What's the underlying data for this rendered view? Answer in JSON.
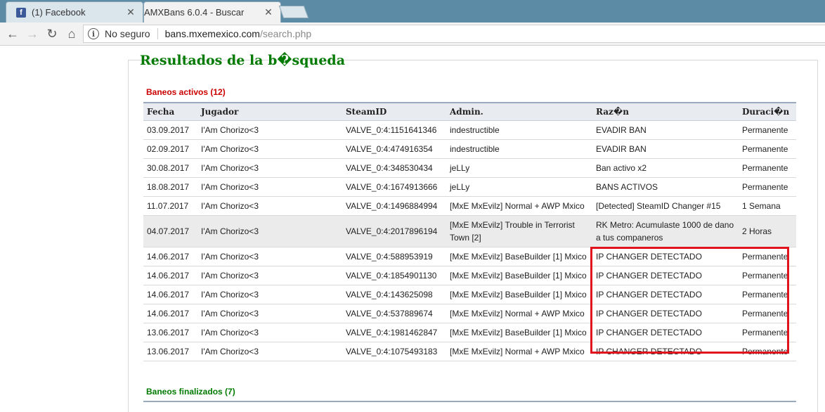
{
  "browser": {
    "tabs": [
      {
        "title": "(1) Facebook",
        "favicon": "facebook-icon",
        "active": false
      },
      {
        "title": "AMXBans 6.0.4 - Buscar",
        "favicon": "page-icon",
        "active": true
      }
    ],
    "omnibox": {
      "security_label": "No seguro",
      "host": "bans.mxemexico.com",
      "path": "/search.php"
    }
  },
  "page": {
    "heading": "Resultados de la b�squeda",
    "active_section": "Baneos activos (12)",
    "finished_section": "Baneos finalizados (7)",
    "columns": [
      "Fecha",
      "Jugador",
      "SteamID",
      "Admin.",
      "Raz�n",
      "Duraci�n"
    ],
    "rows": [
      {
        "fecha": "03.09.2017",
        "jugador": "I'Am Chorizo<3",
        "steamid": "VALVE_0:4:1151641346",
        "admin": "indestructible",
        "razon": "EVADIR BAN",
        "duracion": "Permanente"
      },
      {
        "fecha": "02.09.2017",
        "jugador": "I'Am Chorizo<3",
        "steamid": "VALVE_0:4:474916354",
        "admin": "indestructible",
        "razon": "EVADIR BAN",
        "duracion": "Permanente"
      },
      {
        "fecha": "30.08.2017",
        "jugador": "I'Am Chorizo<3",
        "steamid": "VALVE_0:4:348530434",
        "admin": "jeLLy",
        "razon": "Ban activo x2",
        "duracion": "Permanente"
      },
      {
        "fecha": "18.08.2017",
        "jugador": "I'Am Chorizo<3",
        "steamid": "VALVE_0:4:1674913666",
        "admin": "jeLLy",
        "razon": "BANS ACTIVOS",
        "duracion": "Permanente"
      },
      {
        "fecha": "11.07.2017",
        "jugador": "I'Am Chorizo<3",
        "steamid": "VALVE_0:4:1496884994",
        "admin": "[MxE MxEvilz] Normal + AWP Mxico",
        "razon": "[Detected] SteamID Changer #15",
        "duracion": "1 Semana"
      },
      {
        "fecha": "04.07.2017",
        "jugador": "I'Am Chorizo<3",
        "steamid": "VALVE_0:4:2017896194",
        "admin": "[MxE MxEvilz] Trouble in Terrorist Town [2]",
        "razon": "RK Metro: Acumulaste 1000 de dano a tus companeros",
        "duracion": "2 Horas"
      },
      {
        "fecha": "14.06.2017",
        "jugador": "I'Am Chorizo<3",
        "steamid": "VALVE_0:4:588953919",
        "admin": "[MxE MxEvilz] BaseBuilder [1] Mxico",
        "razon": "IP CHANGER DETECTADO",
        "duracion": "Permanente"
      },
      {
        "fecha": "14.06.2017",
        "jugador": "I'Am Chorizo<3",
        "steamid": "VALVE_0:4:1854901130",
        "admin": "[MxE MxEvilz] BaseBuilder [1] Mxico",
        "razon": "IP CHANGER DETECTADO",
        "duracion": "Permanente"
      },
      {
        "fecha": "14.06.2017",
        "jugador": "I'Am Chorizo<3",
        "steamid": "VALVE_0:4:143625098",
        "admin": "[MxE MxEvilz] BaseBuilder [1] Mxico",
        "razon": "IP CHANGER DETECTADO",
        "duracion": "Permanente"
      },
      {
        "fecha": "14.06.2017",
        "jugador": "I'Am Chorizo<3",
        "steamid": "VALVE_0:4:537889674",
        "admin": "[MxE MxEvilz] Normal + AWP Mxico",
        "razon": "IP CHANGER DETECTADO",
        "duracion": "Permanente"
      },
      {
        "fecha": "13.06.2017",
        "jugador": "I'Am Chorizo<3",
        "steamid": "VALVE_0:4:1981462847",
        "admin": "[MxE MxEvilz] BaseBuilder [1] Mxico",
        "razon": "IP CHANGER DETECTADO",
        "duracion": "Permanente"
      },
      {
        "fecha": "13.06.2017",
        "jugador": "I'Am Chorizo<3",
        "steamid": "VALVE_0:4:1075493183",
        "admin": "[MxE MxEvilz] Normal + AWP Mxico",
        "razon": "IP CHANGER DETECTADO",
        "duracion": "Permanente"
      }
    ]
  },
  "colors": {
    "heading": "#007a00",
    "active_section": "#cc0000",
    "highlight_box": "#e0141e"
  }
}
